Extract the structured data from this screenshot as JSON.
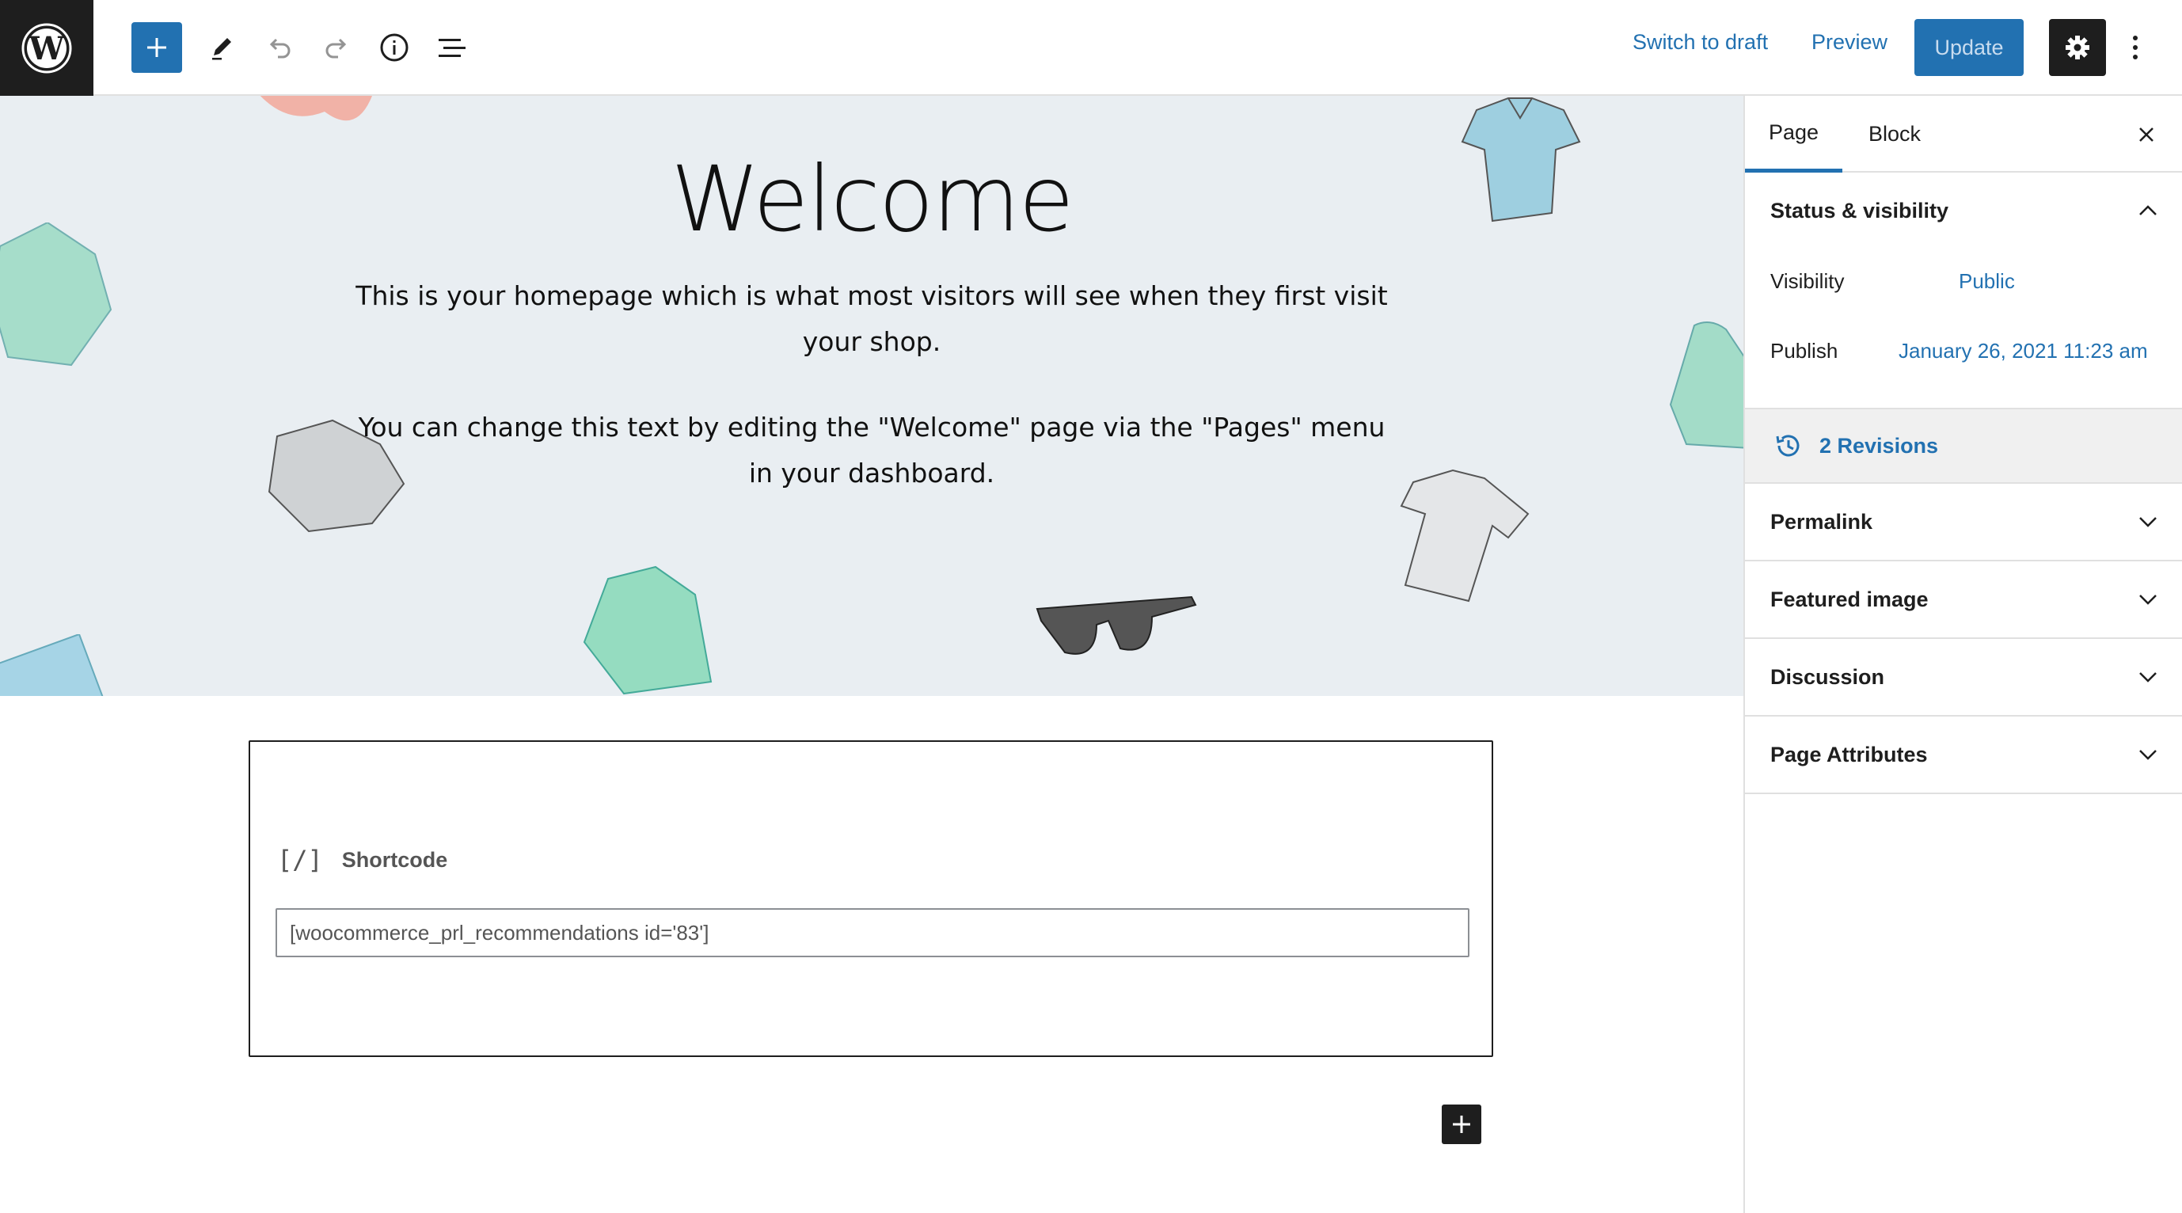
{
  "toolbar": {
    "logo_icon": "wordpress-logo",
    "add_block_icon": "plus-icon",
    "tools_icon": "pencil-icon",
    "undo_icon": "undo-icon",
    "redo_icon": "redo-icon",
    "details_icon": "info-icon",
    "list_view_icon": "list-view-icon",
    "switch_to_draft": "Switch to draft",
    "preview": "Preview",
    "update": "Update",
    "settings_icon": "gear-icon",
    "more_icon": "more-vertical-icon",
    "accent_color": "#2271b1"
  },
  "cover": {
    "title": "Welcome",
    "paragraph_1": "This is your homepage which is what most visitors will see when they first visit your shop.",
    "paragraph_2": "You can change this text by editing the \"Welcome\" page via the \"Pages\" menu in your dashboard.",
    "background_color": "#e9eef2"
  },
  "shortcode_block": {
    "icon": "[/]",
    "label": "Shortcode",
    "value": "[woocommerce_prl_recommendations id='83']"
  },
  "inserter_icon": "plus-icon",
  "sidebar": {
    "tabs": [
      {
        "label": "Page",
        "active": true
      },
      {
        "label": "Block",
        "active": false
      }
    ],
    "close_icon": "close-icon",
    "status_visibility": {
      "title": "Status & visibility",
      "visibility_label": "Visibility",
      "visibility_value": "Public",
      "publish_label": "Publish",
      "publish_value": "January 26, 2021 11:23 am"
    },
    "revisions_label": "2 Revisions",
    "panels": [
      {
        "title": "Permalink"
      },
      {
        "title": "Featured image"
      },
      {
        "title": "Discussion"
      },
      {
        "title": "Page Attributes"
      }
    ]
  }
}
